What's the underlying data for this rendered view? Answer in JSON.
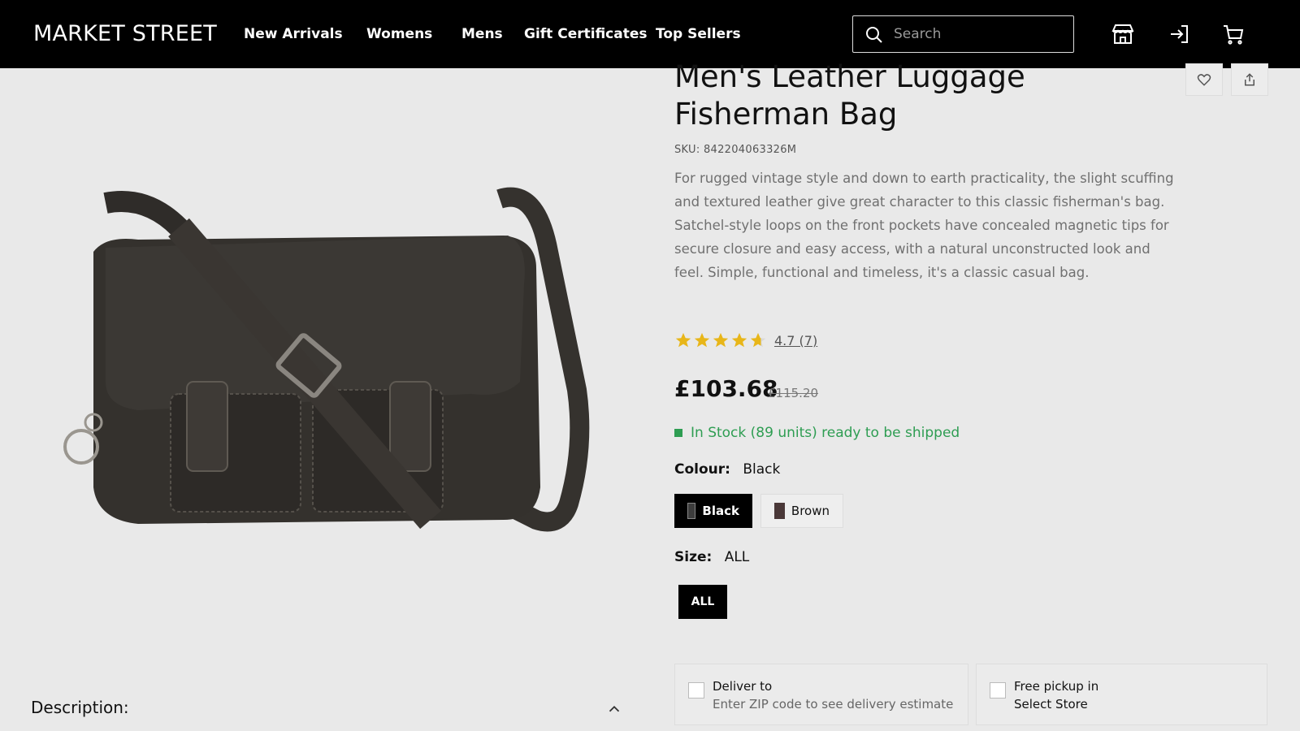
{
  "header": {
    "brand": "MARKET STREET",
    "nav": [
      "New Arrivals",
      "Womens",
      "Mens",
      "Gift Certificates",
      "Top Sellers"
    ],
    "search_placeholder": "Search"
  },
  "product": {
    "title": "Men's Leather Luggage Fisherman Bag",
    "sku": "SKU: 842204063326M",
    "description": "For rugged vintage style and down to earth practicality, the slight scuffing and textured leather give great character to this classic fisherman's bag. Satchel-style loops on the front pockets have concealed magnetic tips for secure closure and easy access, with a natural unconstructed look and feel. Simple, functional and timeless, it's a classic casual bag.",
    "rating_value": 4.7,
    "rating_text": "4.7 (7)",
    "price": "£103.68",
    "old_price": "£115.20",
    "stock": "In Stock (89 units) ready to be shipped",
    "colour_label": "Colour:",
    "colour_value": "Black",
    "colours": [
      "Black",
      "Brown"
    ],
    "size_label": "Size:",
    "size_value": "ALL",
    "sizes": [
      "ALL"
    ]
  },
  "delivery": {
    "deliver_title": "Deliver to",
    "deliver_sub": "Enter ZIP code to see delivery estimate",
    "pickup_title": "Free pickup in",
    "pickup_sub": "Select Store"
  },
  "description_section": {
    "label": "Description:"
  },
  "colors": {
    "header_bg": "#000000",
    "page_bg": "#e9e9e9",
    "stock_green": "#2e9d52",
    "star": "#e8b619"
  }
}
